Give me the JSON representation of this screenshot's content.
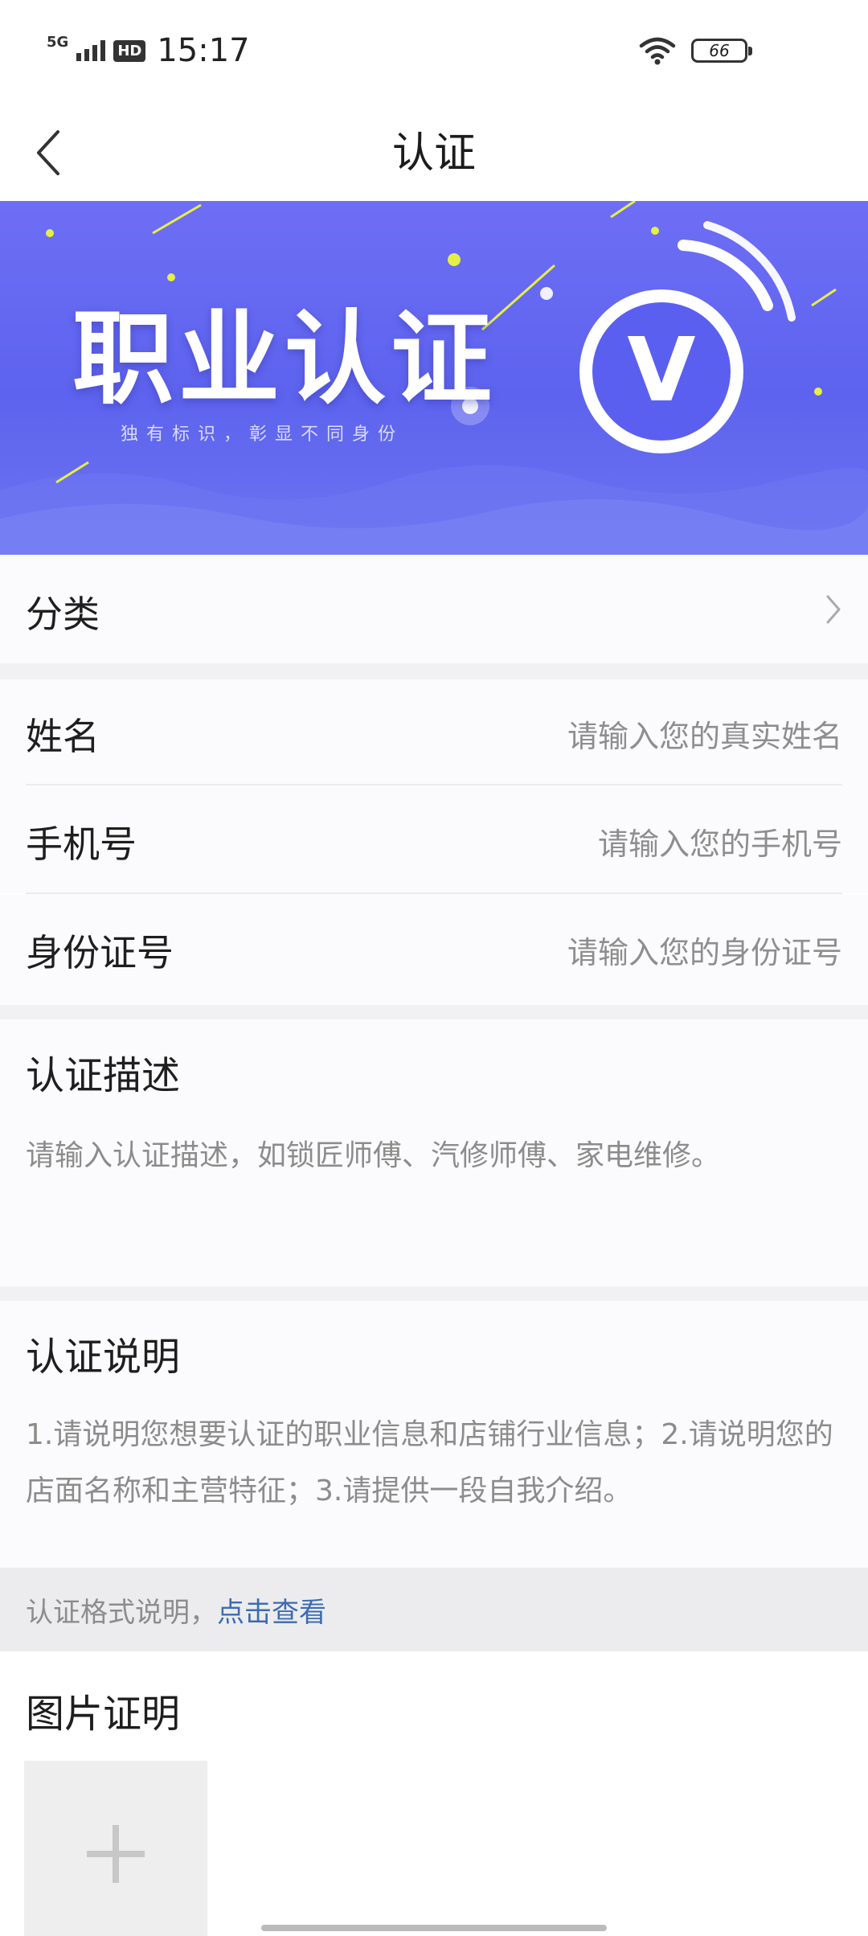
{
  "status_bar": {
    "network": "5G",
    "hd": "HD",
    "time": "15:17",
    "battery": "66"
  },
  "nav": {
    "title": "认证"
  },
  "banner": {
    "title": "职业认证",
    "subtitle": "独有标识，彰显不同身份",
    "badge_letter": "V"
  },
  "category": {
    "label": "分类"
  },
  "form": {
    "name": {
      "label": "姓名",
      "placeholder": "请输入您的真实姓名"
    },
    "phone": {
      "label": "手机号",
      "placeholder": "请输入您的手机号"
    },
    "id_card": {
      "label": "身份证号",
      "placeholder": "请输入您的身份证号"
    }
  },
  "description": {
    "title": "认证描述",
    "placeholder": "请输入认证描述，如锁匠师傅、汽修师傅、家电维修。"
  },
  "instructions": {
    "title": "认证说明",
    "text": "1.请说明您想要认证的职业信息和店铺行业信息；2.请说明您的店面名称和主营特征；3.请提供一段自我介绍。"
  },
  "format_tip": {
    "text": "认证格式说明，",
    "link": "点击查看"
  },
  "photo_proof": {
    "title": "图片证明"
  },
  "colors": {
    "banner": "#5d63ee",
    "link": "#3b6cb3",
    "placeholder": "#8e8e8e"
  },
  "icons": {
    "back": "chevron-left-icon",
    "row_arrow": "chevron-right-icon",
    "add": "plus-icon"
  }
}
